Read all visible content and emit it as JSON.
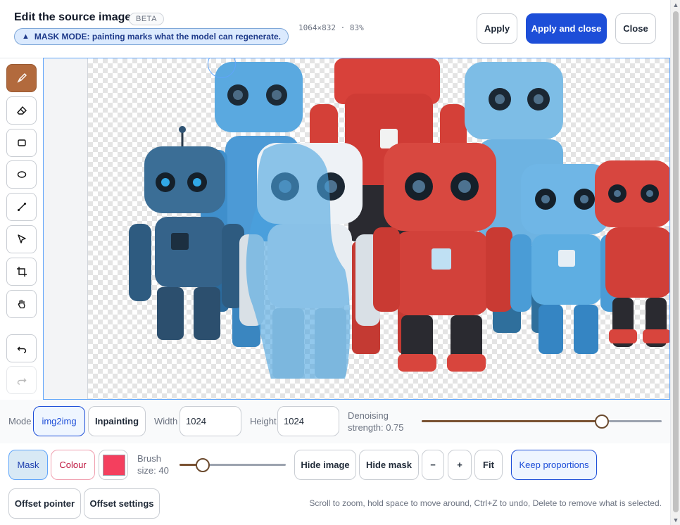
{
  "header": {
    "title": "Edit the source image",
    "badge": "BETA",
    "mask_notice": "MASK MODE: painting marks what the model can regenerate.",
    "image_info": "1064×832 · 83%",
    "apply_label": "Apply",
    "apply_close_label": "Apply and close",
    "close_label": "Close"
  },
  "toolbar": {
    "tools": [
      "brush-icon",
      "eraser-icon",
      "rectangle-icon",
      "ellipse-icon",
      "line-icon",
      "select-icon",
      "crop-icon",
      "hand-icon",
      "undo-icon",
      "redo-icon"
    ],
    "active_tool": "brush-icon",
    "disabled_tools": [
      "redo-icon"
    ]
  },
  "controls": {
    "mode_label": "Mode",
    "mode_options": [
      "img2img",
      "Inpainting"
    ],
    "mode_selected": "img2img",
    "width_label": "Width",
    "width_value": "1024",
    "height_label": "Height",
    "height_value": "1024",
    "denoise_label": "Denoising strength: 0.75",
    "denoise_value": 0.75,
    "mask_label": "Mask",
    "colour_label": "Colour",
    "swatch_color": "#f43f5e",
    "brush_label": "Brush size: 40",
    "brush_fraction": 0.22,
    "hide_image_label": "Hide image",
    "hide_mask_label": "Hide mask",
    "zoom_out_label": "−",
    "zoom_in_label": "+",
    "fit_label": "Fit",
    "keep_proportions_label": "Keep proportions",
    "offset_pointer_label": "Offset pointer",
    "offset_settings_label": "Offset settings",
    "hint": "Scroll to zoom, hold space to move around, Ctrl+Z to undo, Delete to remove what is selected."
  },
  "colors": {
    "accent": "#1d4ed8",
    "active_tool": "#b26a3d",
    "mask_overlay": "#4aa3e0"
  }
}
